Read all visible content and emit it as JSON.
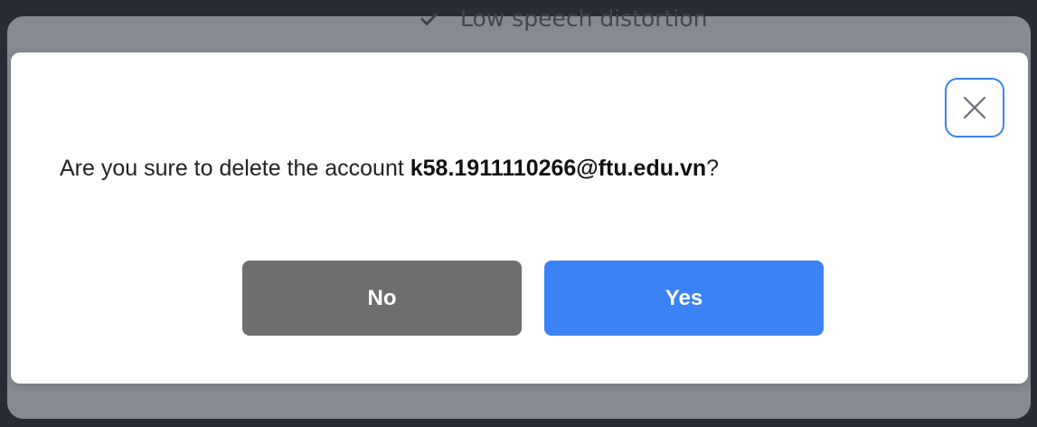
{
  "background": {
    "feature_text": "Low speech distortion",
    "feature_icon": "check-icon"
  },
  "dialog": {
    "close_icon": "close-icon",
    "message_prefix": "Are you sure to delete the account ",
    "account_email": "k58.1911110266@ftu.edu.vn",
    "message_suffix": "?",
    "no_label": "No",
    "yes_label": "Yes"
  },
  "colors": {
    "primary": "#3b82f6",
    "secondary": "#6e6e6e",
    "overlay": "rgba(40, 44, 56, 0.50)"
  }
}
